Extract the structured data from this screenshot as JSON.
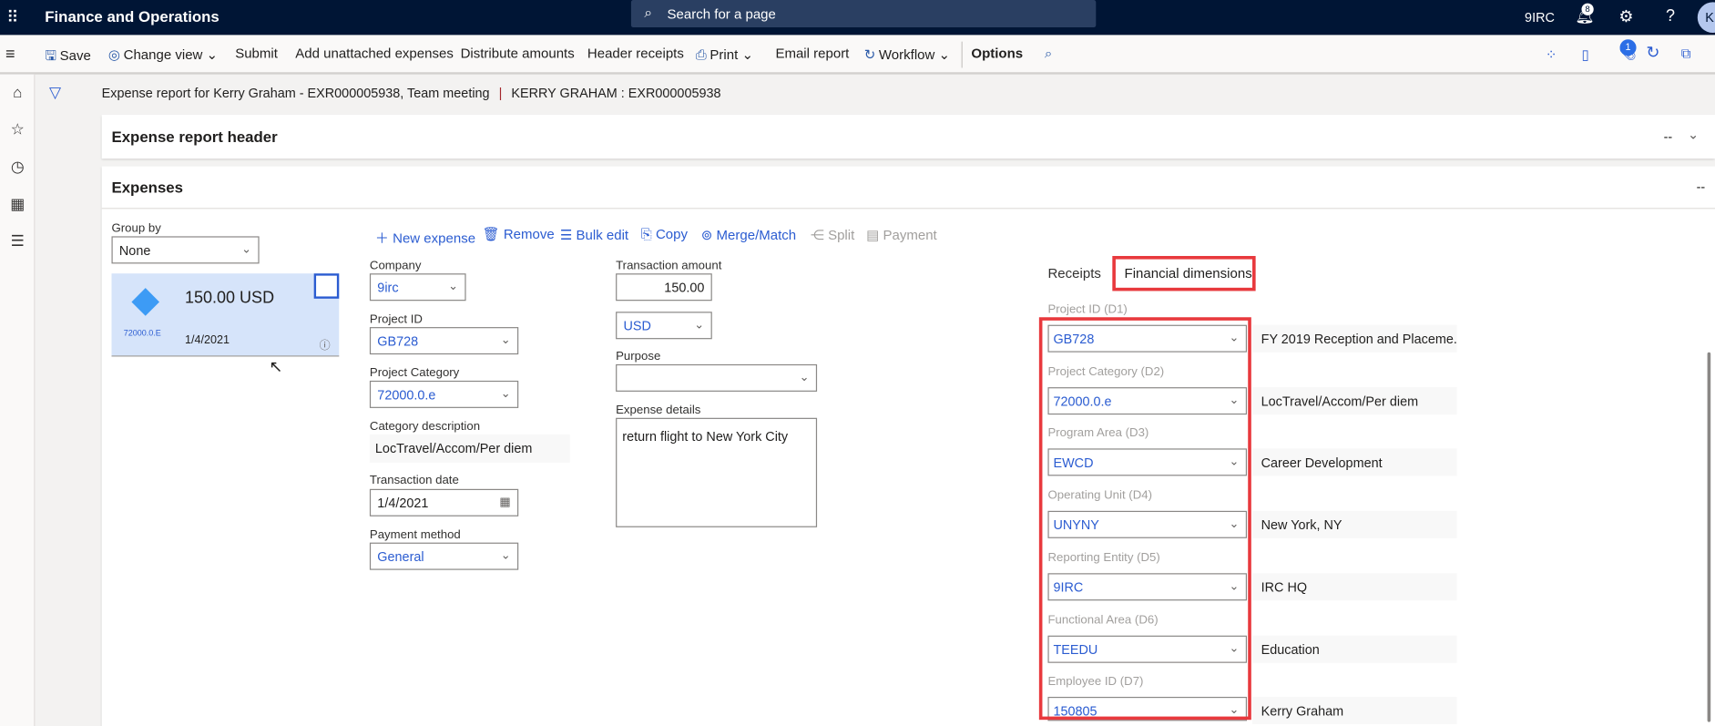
{
  "app": {
    "title": "Finance and Operations",
    "search_placeholder": "Search for a page",
    "company": "9IRC",
    "notifications": "8",
    "avatar": "K"
  },
  "toolbar": {
    "save": "Save",
    "change_view": "Change view",
    "submit": "Submit",
    "add_unattached": "Add unattached expenses",
    "distribute": "Distribute amounts",
    "header_receipts": "Header receipts",
    "print": "Print",
    "email_report": "Email report",
    "workflow": "Workflow",
    "options": "Options",
    "attachments_count": "1"
  },
  "breadcrumb": {
    "title": "Expense report for Kerry Graham - EXR000005938, Team meeting",
    "separator": "|",
    "record": "KERRY GRAHAM : EXR000005938"
  },
  "header_section": {
    "title": "Expense report header",
    "summary": "--"
  },
  "expenses_section": {
    "title": "Expenses",
    "summary": "--"
  },
  "group_by": {
    "label": "Group by",
    "value": "None"
  },
  "card": {
    "amount": "150.00 USD",
    "category": "72000.0.E",
    "date": "1/4/2021"
  },
  "actions": {
    "new_expense": "New expense",
    "remove": "Remove",
    "bulk_edit": "Bulk edit",
    "copy": "Copy",
    "merge_match": "Merge/Match",
    "split": "Split",
    "payment": "Payment"
  },
  "form": {
    "company": {
      "label": "Company",
      "value": "9irc"
    },
    "project_id": {
      "label": "Project ID",
      "value": "GB728"
    },
    "project_category": {
      "label": "Project Category",
      "value": "72000.0.e"
    },
    "category_description": {
      "label": "Category description",
      "value": "LocTravel/Accom/Per diem"
    },
    "transaction_date": {
      "label": "Transaction date",
      "value": "1/4/2021"
    },
    "payment_method": {
      "label": "Payment method",
      "value": "General"
    },
    "transaction_amount": {
      "label": "Transaction amount",
      "value": "150.00"
    },
    "currency": {
      "value": "USD"
    },
    "purpose": {
      "label": "Purpose",
      "value": ""
    },
    "expense_details": {
      "label": "Expense details",
      "value": "return flight to New York City"
    }
  },
  "tabs": {
    "receipts": "Receipts",
    "financial_dimensions": "Financial dimensions",
    "active": "financial_dimensions"
  },
  "dimensions": [
    {
      "label": "Project ID (D1)",
      "value": "GB728",
      "description": "FY 2019 Reception and Placeme..."
    },
    {
      "label": "Project Category (D2)",
      "value": "72000.0.e",
      "description": "LocTravel/Accom/Per diem"
    },
    {
      "label": "Program Area (D3)",
      "value": "EWCD",
      "description": "Career Development"
    },
    {
      "label": "Operating Unit (D4)",
      "value": "UNYNY",
      "description": "New York, NY"
    },
    {
      "label": "Reporting Entity (D5)",
      "value": "9IRC",
      "description": "IRC HQ"
    },
    {
      "label": "Functional Area (D6)",
      "value": "TEEDU",
      "description": "Education"
    },
    {
      "label": "Employee ID (D7)",
      "value": "150805",
      "description": "Kerry Graham"
    }
  ],
  "colors": {
    "topbar": "#001535",
    "accent": "#2b5cd1",
    "highlight": "#e8393d",
    "card": "#d6e4fa"
  }
}
